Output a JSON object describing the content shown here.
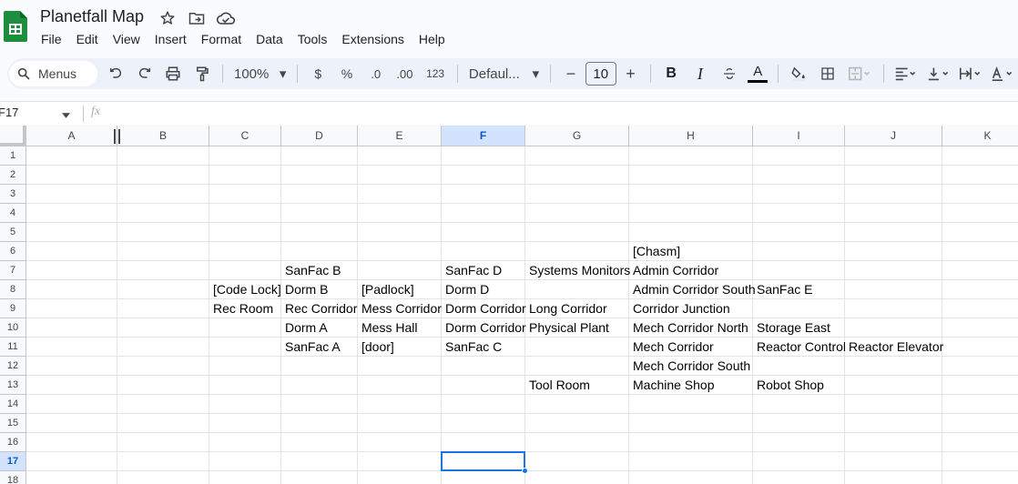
{
  "app": {
    "title": "Planetfall Map",
    "brand_color": "#188038"
  },
  "menu": [
    "File",
    "Edit",
    "View",
    "Insert",
    "Format",
    "Data",
    "Tools",
    "Extensions",
    "Help"
  ],
  "toolbar": {
    "search_label": "Menus",
    "zoom": "100%",
    "currency": "$",
    "percent": "%",
    "dec_decrease": ".0",
    "dec_increase": ".00",
    "number_format": "123",
    "font": "Defaul...",
    "font_size": "10",
    "bold": "B",
    "italic": "I",
    "text_color_letter": "A"
  },
  "formula_bar": {
    "name_box": "F17",
    "fx": "fx"
  },
  "columns": [
    "A",
    "B",
    "C",
    "D",
    "E",
    "F",
    "G",
    "H",
    "I",
    "J",
    "K"
  ],
  "rows": [
    "1",
    "2",
    "3",
    "4",
    "5",
    "6",
    "7",
    "8",
    "9",
    "10",
    "11",
    "12",
    "13",
    "14",
    "15",
    "16",
    "17",
    "18"
  ],
  "selected": {
    "column": "F",
    "row": "17"
  },
  "cells": [
    {
      "ref": "H6",
      "text": "[Chasm]"
    },
    {
      "ref": "D7",
      "text": "SanFac B"
    },
    {
      "ref": "F7",
      "text": "SanFac D"
    },
    {
      "ref": "G7",
      "text": "Systems Monitors"
    },
    {
      "ref": "H7",
      "text": "Admin Corridor"
    },
    {
      "ref": "C8",
      "text": "[Code Lock]"
    },
    {
      "ref": "D8",
      "text": "Dorm B"
    },
    {
      "ref": "E8",
      "text": "[Padlock]"
    },
    {
      "ref": "F8",
      "text": "Dorm D"
    },
    {
      "ref": "H8",
      "text": "Admin Corridor South"
    },
    {
      "ref": "I8",
      "text": "SanFac E"
    },
    {
      "ref": "C9",
      "text": "Rec Room"
    },
    {
      "ref": "D9",
      "text": "Rec Corridor"
    },
    {
      "ref": "E9",
      "text": "Mess Corridor"
    },
    {
      "ref": "F9",
      "text": "Dorm Corridor"
    },
    {
      "ref": "G9",
      "text": "Long Corridor"
    },
    {
      "ref": "H9",
      "text": "Corridor Junction"
    },
    {
      "ref": "D10",
      "text": "Dorm A"
    },
    {
      "ref": "E10",
      "text": "Mess Hall"
    },
    {
      "ref": "F10",
      "text": "Dorm Corridor"
    },
    {
      "ref": "G10",
      "text": "Physical Plant"
    },
    {
      "ref": "H10",
      "text": "Mech Corridor North"
    },
    {
      "ref": "I10",
      "text": "Storage East"
    },
    {
      "ref": "D11",
      "text": "SanFac A"
    },
    {
      "ref": "E11",
      "text": "[door]"
    },
    {
      "ref": "F11",
      "text": "SanFac C"
    },
    {
      "ref": "H11",
      "text": "Mech Corridor"
    },
    {
      "ref": "I11",
      "text": "Reactor Control"
    },
    {
      "ref": "J11",
      "text": "Reactor Elevator"
    },
    {
      "ref": "H12",
      "text": "Mech Corridor South"
    },
    {
      "ref": "G13",
      "text": "Tool Room"
    },
    {
      "ref": "H13",
      "text": "Machine Shop"
    },
    {
      "ref": "I13",
      "text": "Robot Shop"
    }
  ]
}
